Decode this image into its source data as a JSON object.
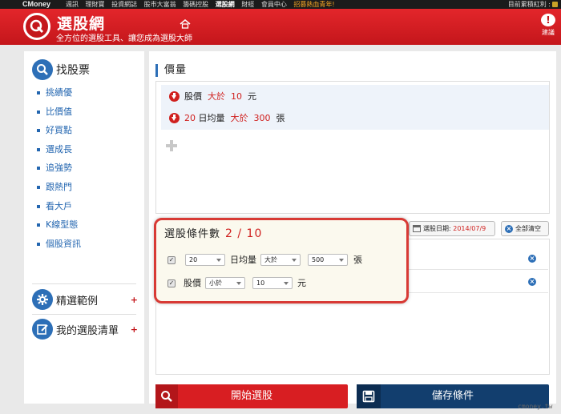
{
  "topnav": {
    "brand": "CMoney",
    "links": [
      "週訊",
      "理財寶",
      "投資網誌",
      "股市大富翁",
      "籌碼控股",
      "選股網",
      "財經",
      "會員中心",
      "招募熱血青年!"
    ],
    "active_index": 5,
    "right_text": "目前累積紅利 :"
  },
  "header": {
    "title": "選股網",
    "slogan": "全方位的選股工具、讓您成為選股大師",
    "suggest_label": "建議",
    "suggest_glyph": "!"
  },
  "sidebar": {
    "heading": "找股票",
    "items": [
      "挑績優",
      "比價值",
      "好買點",
      "選成長",
      "追強勢",
      "跟熱門",
      "看大戶",
      "K線型態",
      "個股資訊"
    ],
    "examples_label": "精選範例",
    "mylist_label": "我的選股清單",
    "plus": "+"
  },
  "main": {
    "section_title": "價量",
    "conditions": [
      {
        "subject": "股價",
        "op": "大於",
        "value": "10",
        "unit": "元"
      },
      {
        "subject": "20日均量",
        "subject_prefix": "20",
        "subject_rest": "日均量",
        "op": "大於",
        "value": "300",
        "unit": "張"
      }
    ],
    "date_label": "選股日期:",
    "date_value": "2014/07/9",
    "clear_label": "全部清空",
    "callout": {
      "title": "選股條件數",
      "count": "2 / 10",
      "rows": [
        {
          "checked": true,
          "sel1": "20",
          "label": "日均量",
          "sel2": "大於",
          "sel3": "500",
          "unit": "張"
        },
        {
          "checked": true,
          "label": "股價",
          "sel2": "小於",
          "sel3": "10",
          "unit": "元"
        }
      ]
    },
    "start_button": "開始選股",
    "save_button": "儲存條件"
  },
  "watermark": "cmoney.tw",
  "colors": {
    "brand_red": "#d81e22",
    "nav_blue": "#2d6fb7",
    "save_navy": "#123e6e"
  }
}
